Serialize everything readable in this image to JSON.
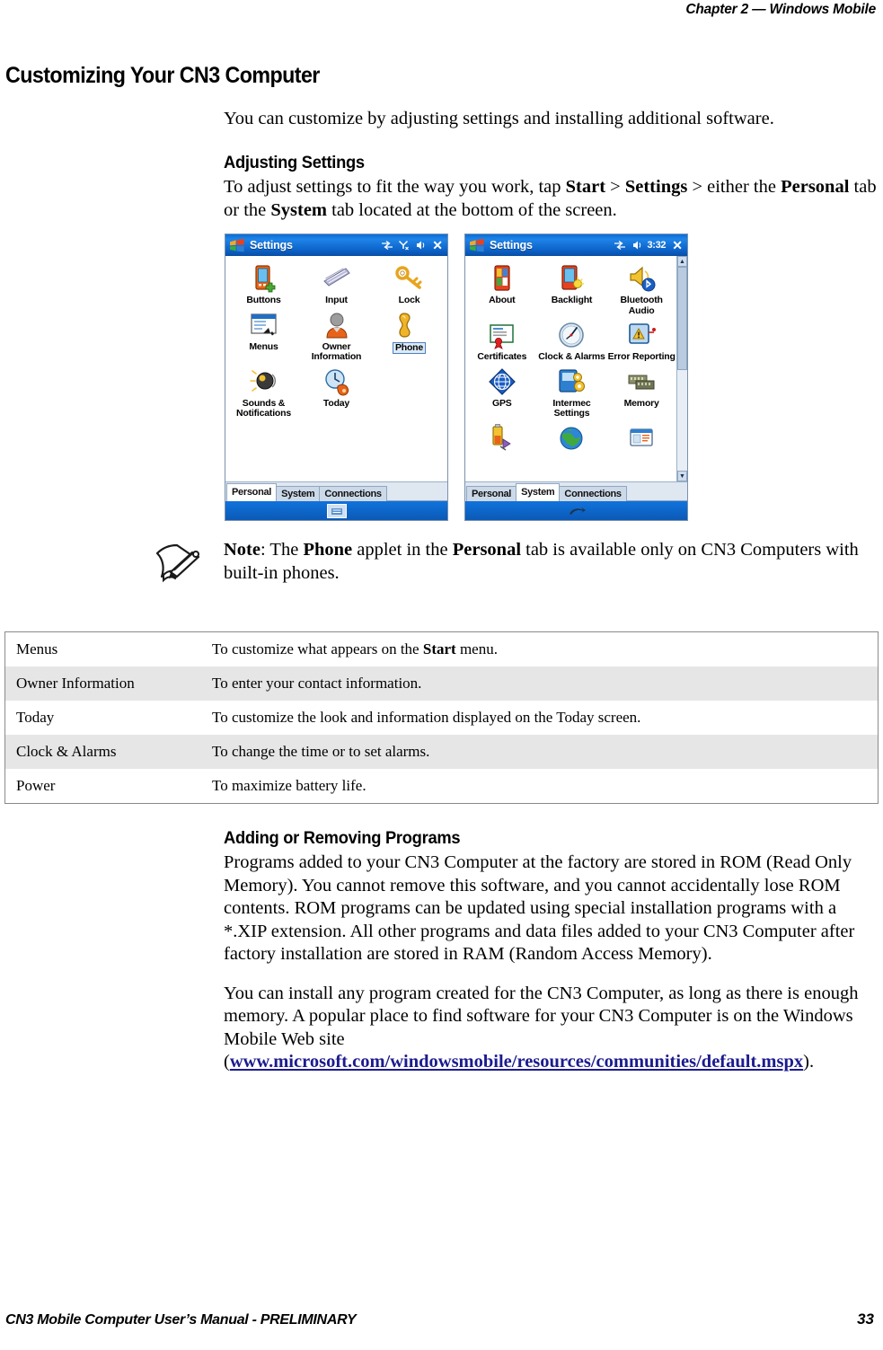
{
  "header": {
    "running_head": "Chapter 2 —  Windows Mobile"
  },
  "main": {
    "h1": "Customizing Your CN3 Computer",
    "intro": "You can customize by adjusting settings and installing additional software.",
    "adjusting": {
      "heading": "Adjusting Settings",
      "line1_a": "To adjust settings to fit the way you work, tap ",
      "line1_start": "Start",
      "line1_b": " > ",
      "line1_settings": "Settings",
      "line1_c": " > either the ",
      "line2_personal": "Personal",
      "line2_a": " tab or the ",
      "line2_system": "System",
      "line2_b": " tab located at the bottom of the screen."
    },
    "note": {
      "label": "Note",
      "a": ": The ",
      "phone": "Phone",
      "b": " applet in the ",
      "personal": "Personal",
      "c": " tab is available only on CN3 Computers with built-in phones.",
      "icon": "note-pencil-icon"
    },
    "adding": {
      "heading": "Adding or Removing Programs",
      "para1": "Programs added to your CN3 Computer at the factory are stored in ROM (Read Only Memory). You cannot remove this software, and you cannot accidentally lose ROM contents. ROM programs can be updated using special installation programs with a *.XIP extension. All other programs and data files added to your CN3 Computer after factory installation are stored in RAM (Random Access Memory).",
      "para2_a": "You can install any program created for the CN3 Computer, as long as there is enough memory. A popular place to find software for your CN3 Computer is on the Windows Mobile Web site (",
      "para2_url": "www.microsoft.com/windowsmobile/resources/communities/default.mspx",
      "para2_b": ")."
    }
  },
  "table": {
    "rows": [
      {
        "term": "Menus",
        "desc_a": "To customize what appears on the ",
        "desc_bold": "Start",
        "desc_b": " menu."
      },
      {
        "term": "Owner Information",
        "desc_a": "To enter your contact information.",
        "desc_bold": "",
        "desc_b": ""
      },
      {
        "term": "Today",
        "desc_a": "To customize the look and information displayed on the Today screen.",
        "desc_bold": "",
        "desc_b": ""
      },
      {
        "term": "Clock & Alarms",
        "desc_a": "To change the time or to set alarms.",
        "desc_bold": "",
        "desc_b": ""
      },
      {
        "term": "Power",
        "desc_a": "To maximize battery life.",
        "desc_bold": "",
        "desc_b": ""
      }
    ]
  },
  "screenshots": {
    "personal": {
      "title": "Settings",
      "statusbar_icons": [
        "connectivity-icon",
        "signal-no-service-icon",
        "volume-icon"
      ],
      "close_label": "✕",
      "applets": [
        {
          "label": "Buttons",
          "icon": "buttons-icon",
          "selected": false
        },
        {
          "label": "Input",
          "icon": "input-keyboard-icon",
          "selected": false
        },
        {
          "label": "Lock",
          "icon": "lock-key-icon",
          "selected": false
        },
        {
          "label": "Menus",
          "icon": "menus-icon",
          "selected": false
        },
        {
          "label": "Owner Information",
          "icon": "owner-information-icon",
          "selected": false
        },
        {
          "label": "Phone",
          "icon": "phone-handset-icon",
          "selected": true
        },
        {
          "label": "Sounds & Notifications",
          "icon": "sounds-notifications-icon",
          "selected": false
        },
        {
          "label": "Today",
          "icon": "today-icon",
          "selected": false
        }
      ],
      "tabs": [
        {
          "label": "Personal",
          "active": true
        },
        {
          "label": "System",
          "active": false
        },
        {
          "label": "Connections",
          "active": false
        }
      ]
    },
    "system": {
      "title": "Settings",
      "statusbar_icons": [
        "connectivity-icon",
        "volume-icon"
      ],
      "time": "3:32",
      "close_label": "✕",
      "applets": [
        {
          "label": "About",
          "icon": "about-icon"
        },
        {
          "label": "Backlight",
          "icon": "backlight-icon"
        },
        {
          "label": "Bluetooth Audio",
          "icon": "bluetooth-audio-icon"
        },
        {
          "label": "Certificates",
          "icon": "certificates-icon"
        },
        {
          "label": "Clock & Alarms",
          "icon": "clock-alarms-icon"
        },
        {
          "label": "Error Reporting",
          "icon": "error-reporting-icon"
        },
        {
          "label": "GPS",
          "icon": "gps-icon"
        },
        {
          "label": "Intermec Settings",
          "icon": "intermec-settings-icon"
        },
        {
          "label": "Memory",
          "icon": "memory-icon"
        },
        {
          "label": "",
          "icon": "power-battery-icon"
        },
        {
          "label": "",
          "icon": "regional-settings-globe-icon"
        },
        {
          "label": "",
          "icon": "screen-icon"
        }
      ],
      "tabs": [
        {
          "label": "Personal",
          "active": false
        },
        {
          "label": "System",
          "active": true
        },
        {
          "label": "Connections",
          "active": false
        }
      ]
    }
  },
  "footer": {
    "left": "CN3 Mobile Computer User’s Manual - PRELIMINARY",
    "page": "33"
  }
}
